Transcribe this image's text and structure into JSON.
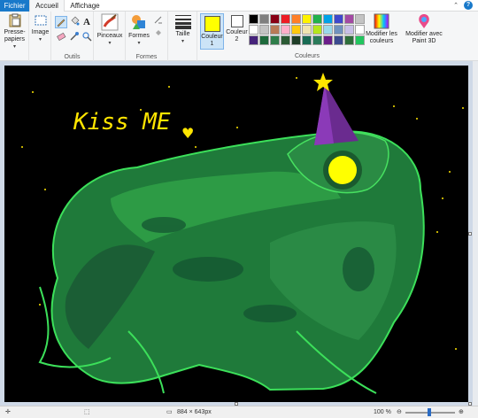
{
  "tabs": {
    "file": "Fichier",
    "home": "Accueil",
    "view": "Affichage"
  },
  "ribbon": {
    "clipboard": {
      "label": "Presse-papiers"
    },
    "image": {
      "label": "Image"
    },
    "tools": {
      "group_label": "Outils"
    },
    "brushes": {
      "label": "Pinceaux"
    },
    "shapes": {
      "label": "Formes",
      "group_label": "Formes"
    },
    "size": {
      "label": "Taille"
    },
    "color1": {
      "label": "Couleur 1",
      "value": "#ffff00"
    },
    "color2": {
      "label": "Couleur 2",
      "value": "#ffffff"
    },
    "colors_group_label": "Couleurs",
    "edit_colors": {
      "label": "Modifier les couleurs"
    },
    "paint3d": {
      "label": "Modifier avec Paint 3D"
    },
    "palette": [
      "#000000",
      "#7f7f7f",
      "#880015",
      "#ed1c24",
      "#ff7f27",
      "#fff200",
      "#22b14c",
      "#00a2e8",
      "#3f48cc",
      "#a349a4",
      "#c3c3c3",
      "#ffffff",
      "#c3c3c3",
      "#b97a57",
      "#ffaec9",
      "#ffc90e",
      "#efe4b0",
      "#b5e61d",
      "#99d9ea",
      "#7092be",
      "#c8bfe7",
      "#ffffff",
      "#46237a",
      "#1e6a3c",
      "#2f7d4a",
      "#2b5a34",
      "#1f3e28",
      "#196b54",
      "#2b7a5a",
      "#6b1e8a",
      "#3c4b8f",
      "#2e6e3a",
      "#22c55e"
    ]
  },
  "canvas": {
    "text": "Kiss ME",
    "heart": "♥"
  },
  "status": {
    "dimensions": "884 × 643px",
    "zoom": "100 %"
  }
}
